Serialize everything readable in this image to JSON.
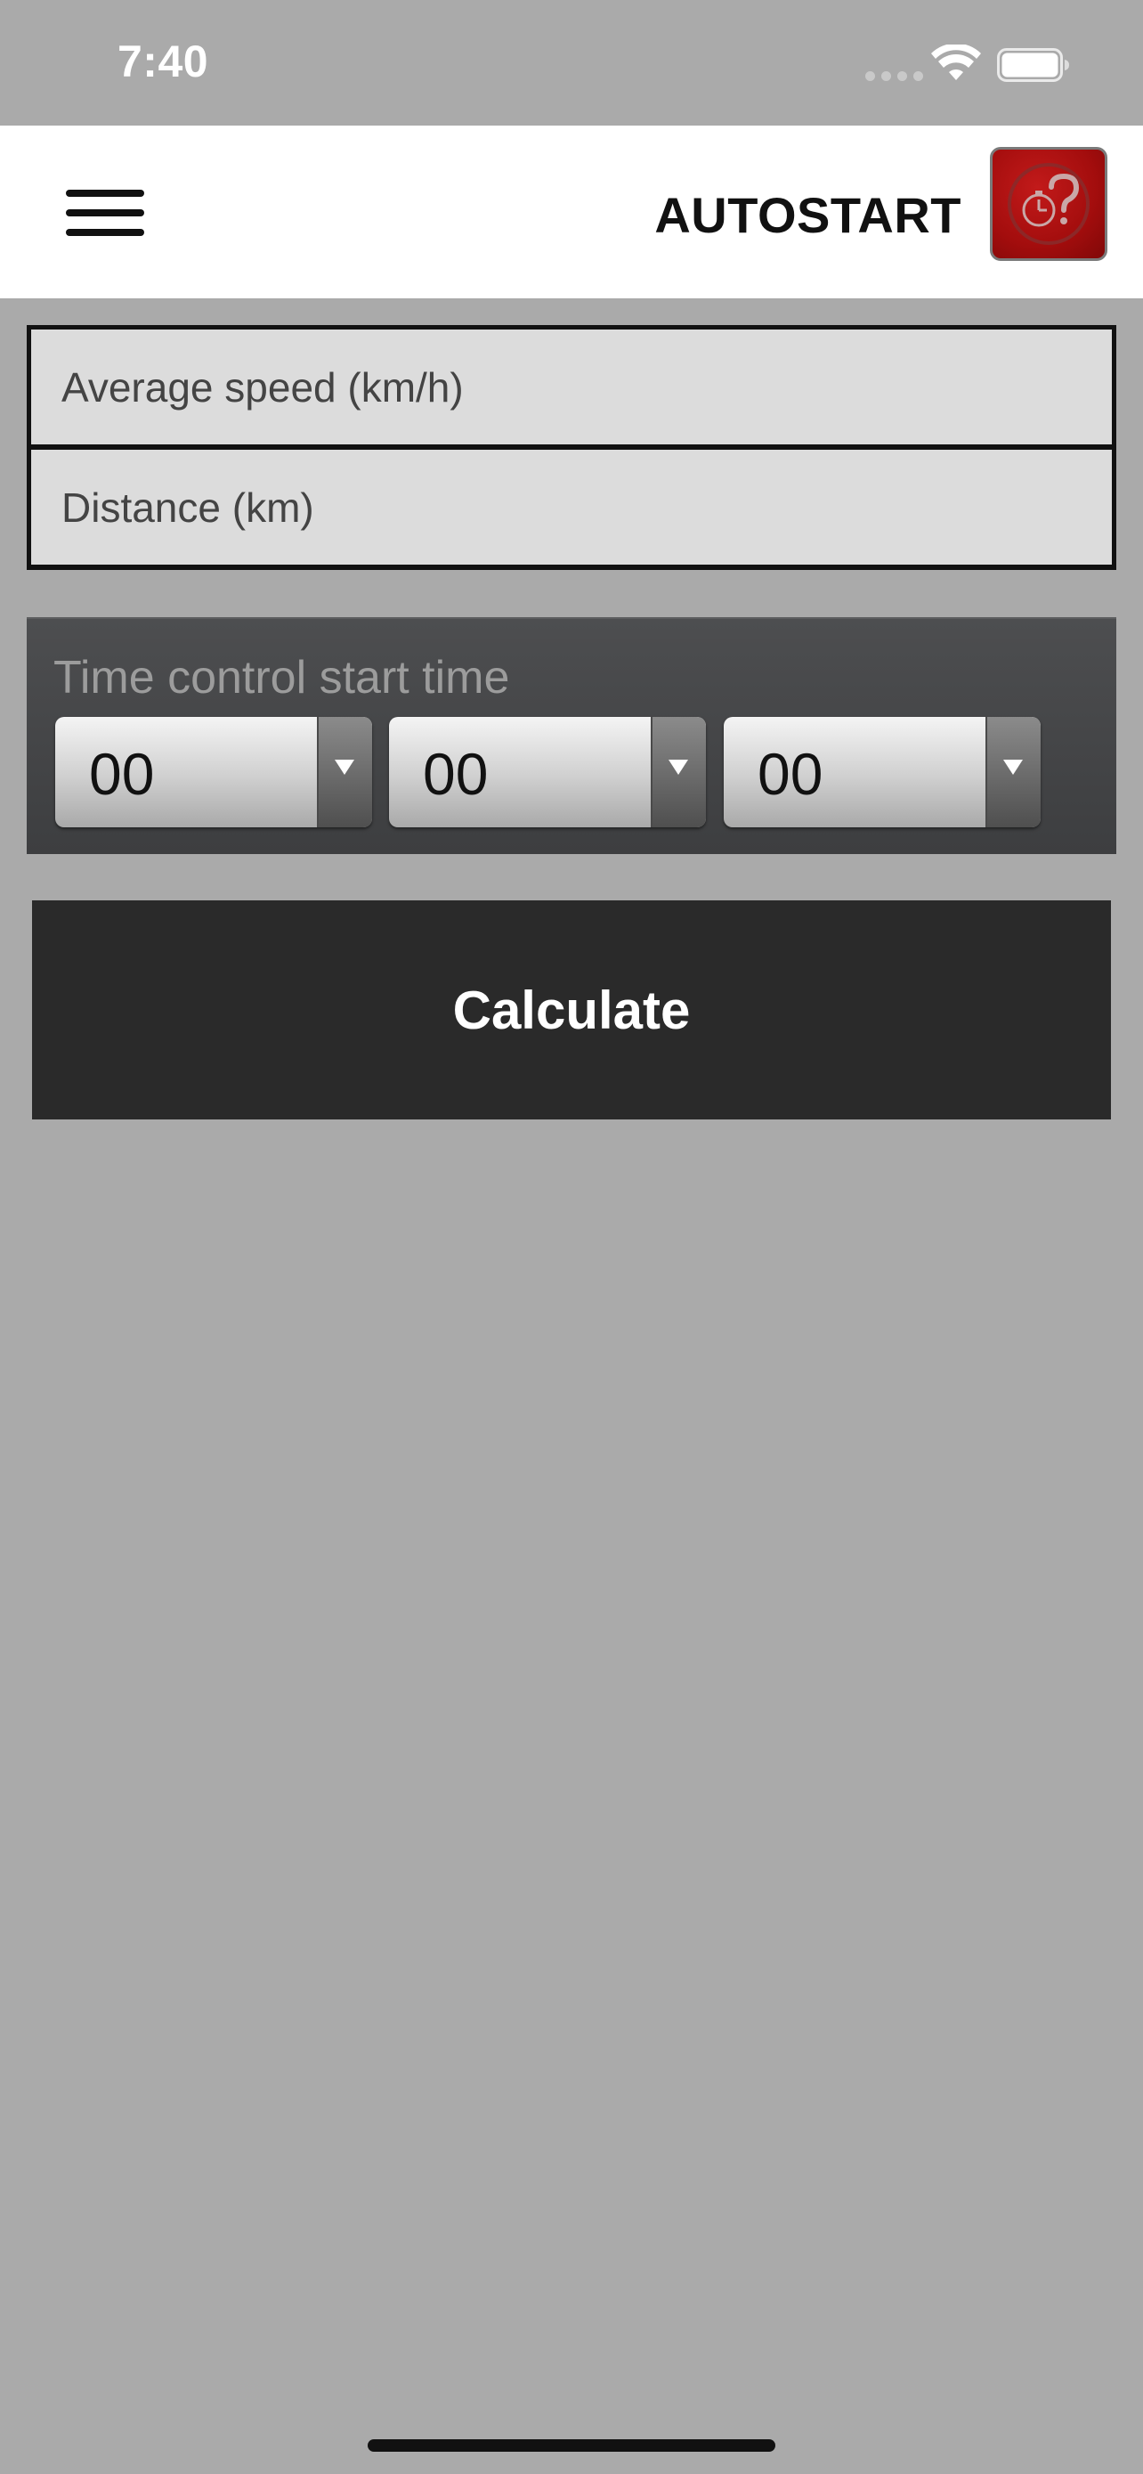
{
  "status_bar": {
    "time": "7:40"
  },
  "header": {
    "title": "AUTOSTART",
    "menu_icon": "hamburger-menu-icon",
    "help_icon": "stopwatch-question-icon"
  },
  "inputs": {
    "average_speed_placeholder": "Average speed (km/h)",
    "distance_placeholder": "Distance (km)"
  },
  "time_control": {
    "label": "Time control start time",
    "hours": "00",
    "minutes": "00",
    "seconds": "00"
  },
  "actions": {
    "calculate_label": "Calculate"
  },
  "colors": {
    "background": "#aaaaaa",
    "header_background": "#ffffff",
    "button_background": "#2a2a2a",
    "help_logo_red": "#a30d0d"
  }
}
